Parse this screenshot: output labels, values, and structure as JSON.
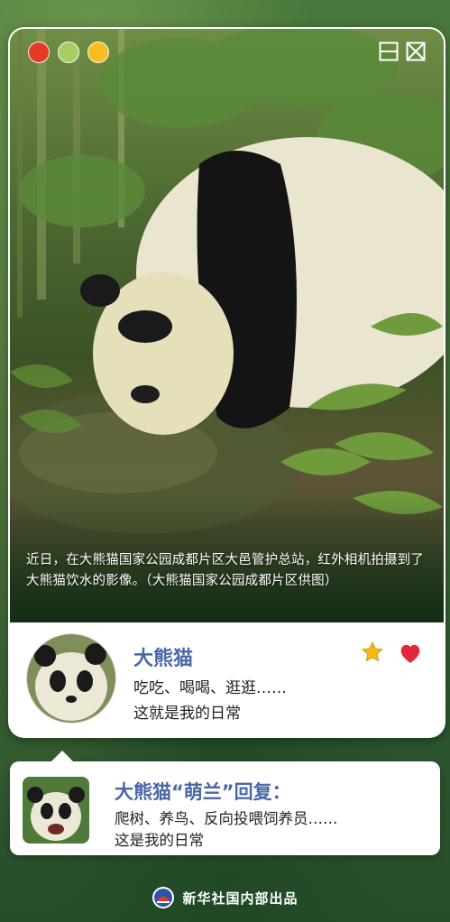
{
  "photo": {
    "caption": "近日，在大熊猫国家公园成都片区大邑管护总站，红外相机拍摄到了大熊猫饮水的影像。（大熊猫国家公园成都片区供图）"
  },
  "window_controls": {
    "dots": [
      "#e23a26",
      "#a6cf63",
      "#f6be1e"
    ],
    "buttons": [
      "minimize-icon",
      "close-icon"
    ]
  },
  "profile": {
    "name": "大熊猫",
    "line1": "吃吃、喝喝、逛逛……",
    "line2": "这就是我的日常",
    "icons": [
      "star-icon",
      "heart-icon"
    ],
    "star_color": "#f5b91a",
    "heart_color": "#e3263a"
  },
  "reply": {
    "title": "大熊猫“萌兰”回复：",
    "line1": "爬树、养鸟、反向投喂饲养员……",
    "line2": "这是我的日常"
  },
  "footer": {
    "text": "新华社国内部出品",
    "logo": "xinhua-logo-icon"
  },
  "accent_color": "#4a67a8"
}
